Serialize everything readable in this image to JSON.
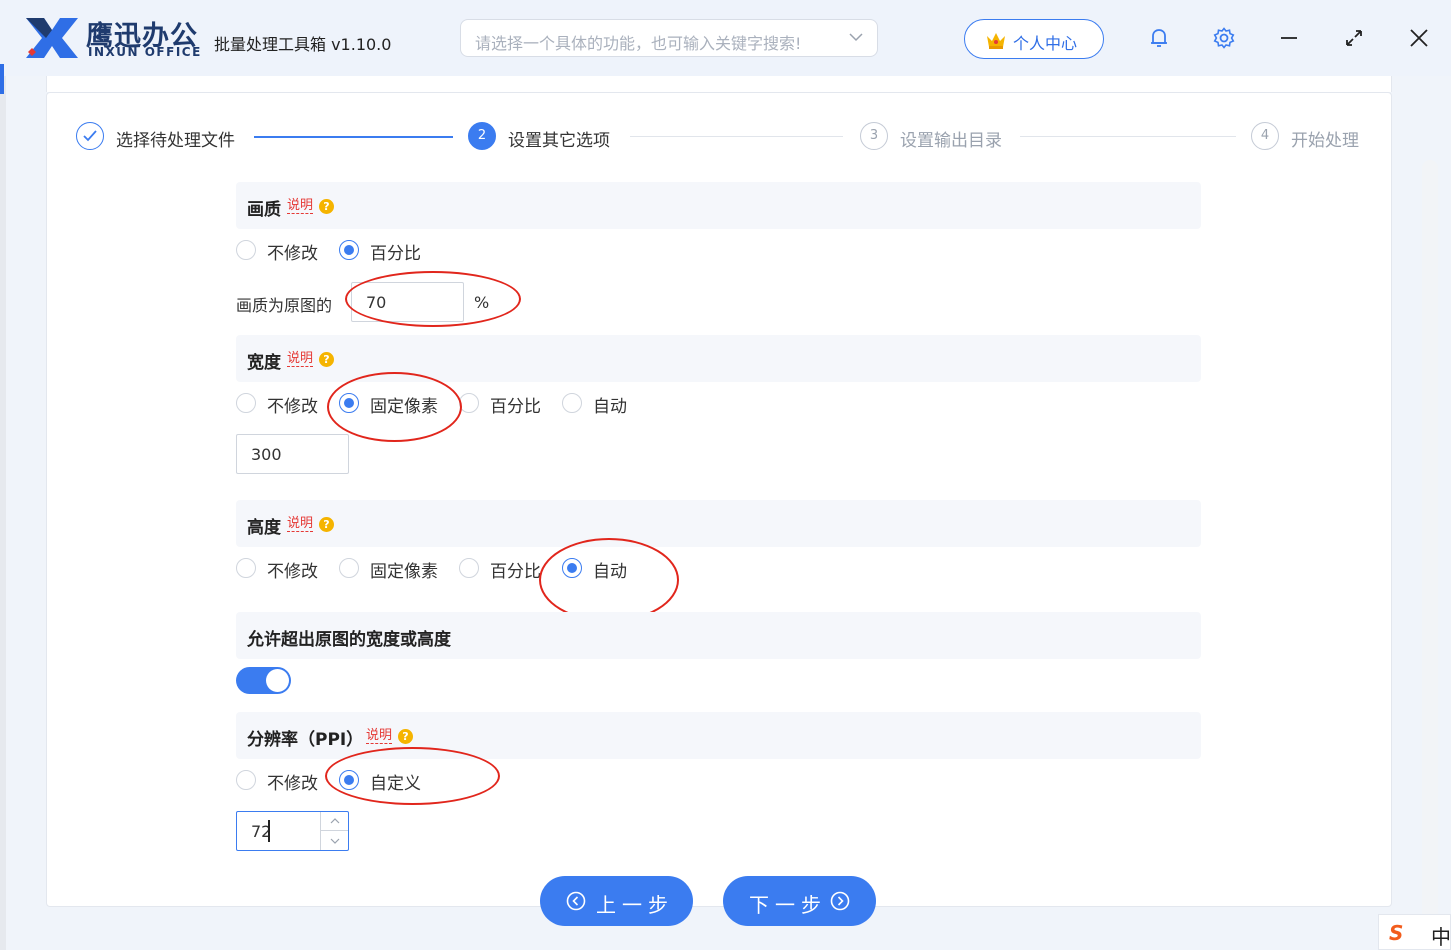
{
  "app": {
    "brand_cn": "鹰迅办公",
    "brand_en": "INXUN OFFICE",
    "title": "批量处理工具箱 v1.10.0",
    "search_placeholder": "请选择一个具体的功能，也可输入关键字搜索!",
    "user_center": "个人中心",
    "accent": "#3b7cf0",
    "icons": [
      "logo-x",
      "chevron-down-icon",
      "crown-icon",
      "bell-icon",
      "gear-icon",
      "minimize-icon",
      "maximize-icon",
      "close-icon"
    ]
  },
  "steps": [
    {
      "num": "✓",
      "label": "选择待处理文件",
      "state": "done"
    },
    {
      "num": "2",
      "label": "设置其它选项",
      "state": "active"
    },
    {
      "num": "3",
      "label": "设置输出目录",
      "state": "pending"
    },
    {
      "num": "4",
      "label": "开始处理",
      "state": "pending"
    }
  ],
  "help": {
    "label": "说明",
    "q": "?"
  },
  "quality": {
    "title": "画质",
    "options": [
      "不修改",
      "百分比"
    ],
    "selected": 1,
    "field_label": "画质为原图的",
    "value": "70",
    "unit": "%"
  },
  "width": {
    "title": "宽度",
    "options": [
      "不修改",
      "固定像素",
      "百分比",
      "自动"
    ],
    "selected": 1,
    "value": "300"
  },
  "height": {
    "title": "高度",
    "options": [
      "不修改",
      "固定像素",
      "百分比",
      "自动"
    ],
    "selected": 3
  },
  "allow_exceed": {
    "title": "允许超出原图的宽度或高度",
    "enabled": true
  },
  "resolution": {
    "title": "分辨率（PPI）",
    "options": [
      "不修改",
      "自定义"
    ],
    "selected": 1,
    "value": "72"
  },
  "buttons": {
    "prev": "上一步",
    "next": "下一步"
  },
  "ime": {
    "logo": "S",
    "lang": "中"
  }
}
